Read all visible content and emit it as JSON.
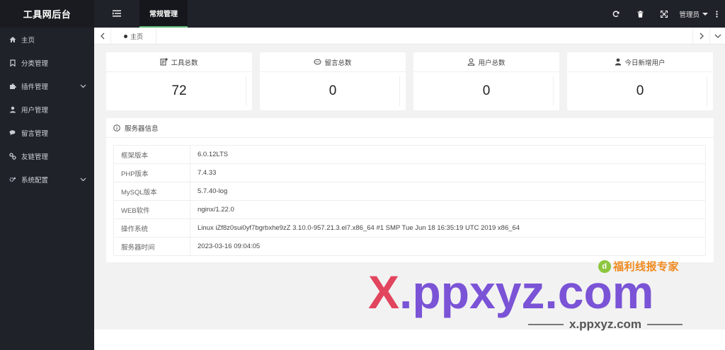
{
  "app": {
    "title": "工具网后台"
  },
  "sidebar": {
    "items": [
      {
        "label": "主页",
        "icon": "home-icon",
        "has_children": false
      },
      {
        "label": "分类管理",
        "icon": "bookmark-icon",
        "has_children": false
      },
      {
        "label": "插件管理",
        "icon": "puzzle-icon",
        "has_children": true
      },
      {
        "label": "用户管理",
        "icon": "user-icon",
        "has_children": false
      },
      {
        "label": "留言管理",
        "icon": "comments-icon",
        "has_children": false
      },
      {
        "label": "友链管理",
        "icon": "link-icon",
        "has_children": false
      },
      {
        "label": "系统配置",
        "icon": "cogs-icon",
        "has_children": true
      }
    ]
  },
  "header": {
    "active_tab": "常规管理",
    "icons": [
      "refresh-icon",
      "trash-icon",
      "fullscreen-icon"
    ],
    "user": "管理员"
  },
  "tabbar": {
    "home_tab": "主页"
  },
  "stats": [
    {
      "label": "工具总数",
      "value": "72",
      "icon": "tools-icon"
    },
    {
      "label": "留言总数",
      "value": "0",
      "icon": "message-icon"
    },
    {
      "label": "用户总数",
      "value": "0",
      "icon": "users-icon"
    },
    {
      "label": "今日新增用户",
      "value": "0",
      "icon": "new-user-icon"
    }
  ],
  "server": {
    "title": "服务器信息",
    "rows": [
      {
        "key": "框架版本",
        "value": "6.0.12LTS"
      },
      {
        "key": "PHP版本",
        "value": "7.4.33"
      },
      {
        "key": "MySQL版本",
        "value": "5.7.40-log"
      },
      {
        "key": "WEB软件",
        "value": "nginx/1.22.0"
      },
      {
        "key": "操作系统",
        "value": "Linux iZf8z0sui0yf7bgrbxhe9zZ 3.10.0-957.21.3.el7.x86_64 #1 SMP Tue Jun 18 16:35:19 UTC 2019 x86_64"
      },
      {
        "key": "服务器时间",
        "value": "2023-03-16 09:04:05"
      }
    ]
  },
  "watermark": {
    "brand": "福利线报专家",
    "big_x": "X",
    "big_rest": ".ppxyz.com",
    "small": "x.ppxyz.com"
  },
  "colors": {
    "sidebar_bg": "#20222a",
    "accent": "#5fb878",
    "watermark_purple": "#7a53d6",
    "watermark_red": "#e2455e",
    "watermark_orange": "#f08a1e"
  }
}
